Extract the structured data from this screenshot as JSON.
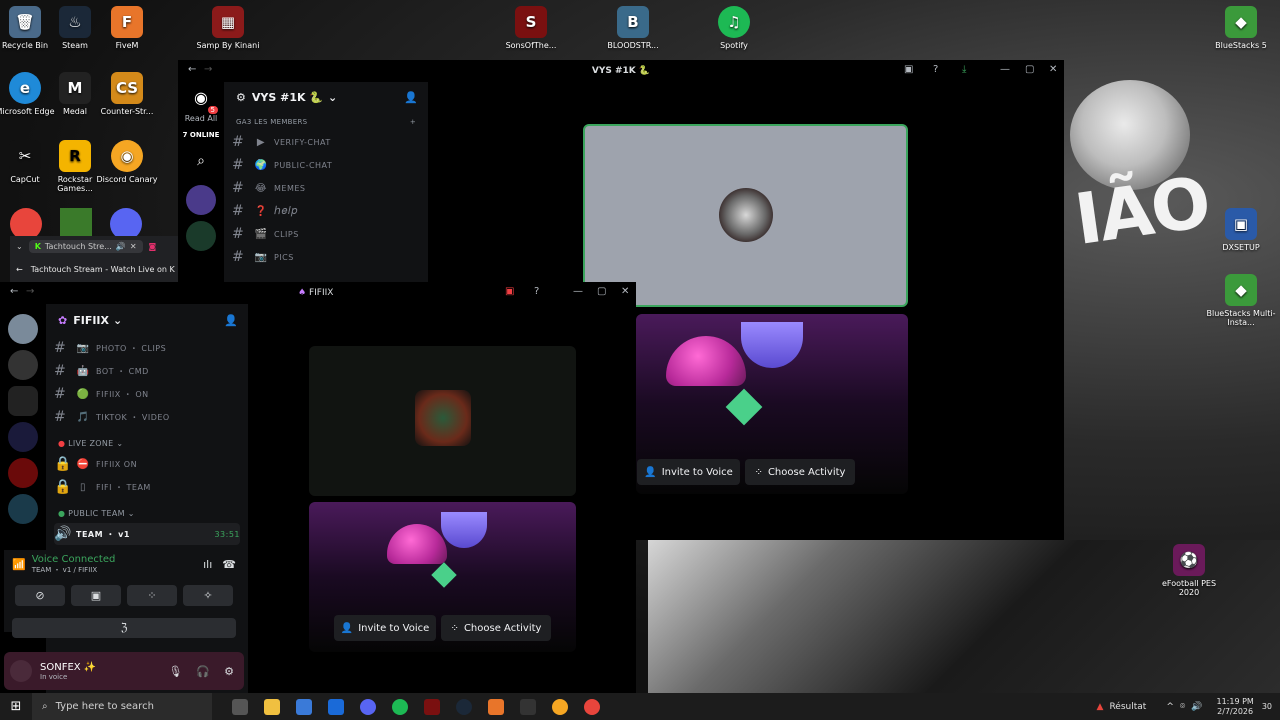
{
  "desktop": {
    "icons": [
      {
        "label": "Recycle Bin",
        "glyph": "🗑",
        "color": "#4a6a8a",
        "icon": "recycle-bin-icon"
      },
      {
        "label": "Steam",
        "glyph": "♨",
        "color": "#1b2838",
        "icon": "steam-icon"
      },
      {
        "label": "FiveM",
        "glyph": "F",
        "color": "#e8752a",
        "icon": "fivem-icon"
      },
      {
        "label": "Samp By Kinani",
        "glyph": "▦",
        "color": "#8b1a1a",
        "icon": "samp-icon"
      },
      {
        "label": "SonsOfThe...",
        "glyph": "S",
        "color": "#7a1010",
        "icon": "sons-icon"
      },
      {
        "label": "BLOODSTR...",
        "glyph": "B",
        "color": "#3a6a8a",
        "icon": "bloodstrike-icon"
      },
      {
        "label": "Spotify",
        "glyph": "♫",
        "color": "#1db954",
        "icon": "spotify-icon"
      },
      {
        "label": "BlueStacks 5",
        "glyph": "◆",
        "color": "#3b9a3b",
        "icon": "bluestacks-icon"
      },
      {
        "label": "Microsoft Edge",
        "glyph": "e",
        "color": "#1f8ad8",
        "icon": "edge-icon"
      },
      {
        "label": "Medal",
        "glyph": "M",
        "color": "#222",
        "icon": "medal-icon"
      },
      {
        "label": "Counter-Str...",
        "glyph": "CS",
        "color": "#d48a1a",
        "icon": "counter-strike-icon"
      },
      {
        "label": "CapCut",
        "glyph": "✂",
        "color": "#111",
        "icon": "capcut-icon"
      },
      {
        "label": "Rockstar Games...",
        "glyph": "R",
        "color": "#f4b400",
        "icon": "rockstar-icon"
      },
      {
        "label": "Discord Canary",
        "glyph": "◉",
        "color": "#f5a623",
        "icon": "discord-canary-icon"
      },
      {
        "label": "DXSETUP",
        "glyph": "▣",
        "color": "#2a5aa8",
        "icon": "dxsetup-icon"
      },
      {
        "label": "BlueStacks Multi-Insta...",
        "glyph": "◆",
        "color": "#3b9a3b",
        "icon": "bluestacks-multi-icon"
      },
      {
        "label": "eFootball PES 2020",
        "glyph": "⚽",
        "color": "#6a1a5a",
        "icon": "efootball-icon"
      }
    ],
    "deco": "IÃO"
  },
  "browser": {
    "tab_label": "Tachtouch Stre...",
    "page_title": "Tachtouch Stream - Watch Live on K"
  },
  "win_big": {
    "title": "VYS #1K 🐍",
    "rail": {
      "read_all": "Read All",
      "online": "7 ONLINE",
      "badge": "5"
    },
    "server_name": "VYS #1K 🐍",
    "category": "GA3 LES MEMBERS",
    "channels": [
      {
        "emoji": "▶",
        "name": "VERIFY-CHAT"
      },
      {
        "emoji": "🌍",
        "name": "PUBLIC-CHAT"
      },
      {
        "emoji": "😂",
        "name": "MEMES"
      },
      {
        "emoji": "❓",
        "name": "ℎ𝑒𝑙𝑝"
      },
      {
        "emoji": "🎬",
        "name": "CLIPS"
      },
      {
        "emoji": "📷",
        "name": "PICS"
      }
    ],
    "invite": "Invite to Voice",
    "activity": "Choose Activity"
  },
  "win_small": {
    "title": "FIFIIX",
    "server_name": "FIFIIX",
    "channels": [
      {
        "emoji": "📷",
        "name": "PHOTO ・ CLIPS"
      },
      {
        "emoji": "🤖",
        "name": "BOT ・ CMD"
      },
      {
        "emoji": "🟢",
        "name": "FIFIIX ・ ON"
      },
      {
        "emoji": "🎵",
        "name": "TIKTOK ・ VIDEO"
      }
    ],
    "live_zone": "LIVE ZONE",
    "live_channels": [
      {
        "emoji": "⛔",
        "name": "FIFIIX ON"
      },
      {
        "emoji": "▯",
        "name": "FIFI ・ TEAM"
      }
    ],
    "public_team": "PUBLIC TEAM",
    "voice_channel": {
      "name": "TEAM ・ v1",
      "timer": "33:51"
    },
    "voice_connected": "Voice Connected",
    "voice_sub": "TEAM ・ v1 / FIFIIX",
    "user": {
      "name": "SONFEX ✨",
      "status": "In voice"
    },
    "invite": "Invite to Voice",
    "activity": "Choose Activity"
  },
  "taskbar": {
    "search_placeholder": "Type here to search",
    "weather": "Résultat",
    "time": "11:19 PM",
    "date": "2/7/2026",
    "notifications": "30"
  },
  "colors": {
    "accent_green": "#3ba55d",
    "discord_red": "#f23f43",
    "purple": "#5b2a7a"
  }
}
